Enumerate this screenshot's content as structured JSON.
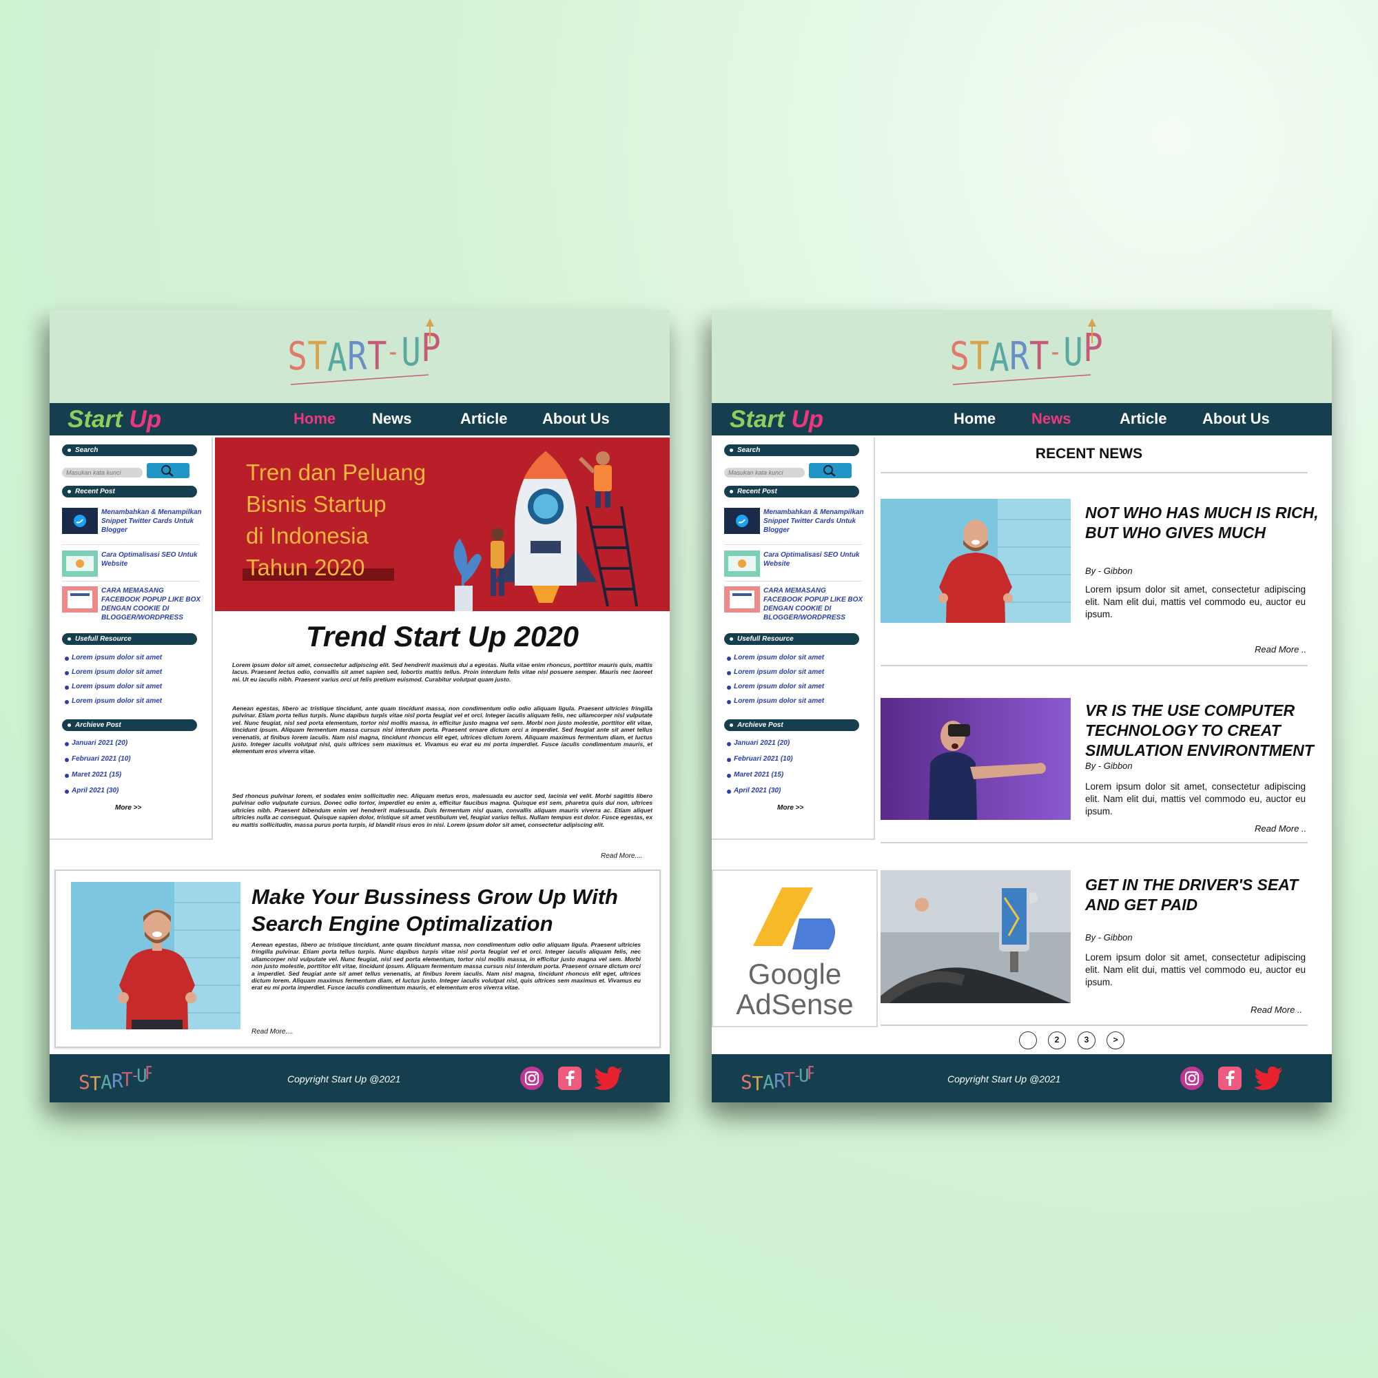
{
  "brand": {
    "part1": "Start",
    "part2": " Up"
  },
  "nav": [
    "Home",
    "News",
    "Article",
    "About Us"
  ],
  "sidebar": {
    "search_label": "Search",
    "search_placeholder": "Masukan kata kunci",
    "recent_label": "Recent Post",
    "recent_posts": [
      "Menambahkan & Menampilkan Snippet Twitter Cards Untuk Blogger",
      "Cara Optimalisasi SEO Untuk Website",
      "CARA MEMASANG FACEBOOK POPUP LIKE BOX DENGAN COOKIE DI BLOGGER/WORDPRESS"
    ],
    "resource_label": "Usefull Resource",
    "resources": [
      "Lorem ipsum dolor sit amet",
      "Lorem ipsum dolor sit amet",
      "Lorem ipsum dolor sit amet",
      "Lorem ipsum dolor sit amet"
    ],
    "archive_label": "Archieve Post",
    "archives": [
      "Januari 2021 (20)",
      "Februari 2021 (10)",
      "Maret 2021 (15)",
      "April 2021 (30)"
    ],
    "more": "More >>"
  },
  "home": {
    "hero_lines": [
      "Tren dan Peluang",
      "Bisnis Startup",
      "di Indonesia",
      "Tahun 2020"
    ],
    "article_title": "Trend Start Up 2020",
    "paragraphs": [
      "Lorem ipsum dolor sit amet, consectetur adipiscing elit. Sed hendrerit maximus dui a egestas. Nulla vitae enim rhoncus, porttitor mauris quis, mattis lacus. Praesent lectus odio, convallis sit amet sapien sed, lobortis mattis tellus. Proin interdum felis vitae nisl posuere semper. Mauris nec laoreet mi. Ut eu iaculis nibh. Praesent varius orci ut felis pretium euismod. Curabitur volutpat quam justo.",
      "Aenean egestas, libero ac tristique tincidunt, ante quam tincidunt massa, non condimentum odio odio aliquam ligula. Praesent ultricies fringilla pulvinar. Etiam porta tellus turpis. Nunc dapibus turpis vitae nisl porta feugiat vel et orci. Integer iaculis aliquam felis, nec ullamcorper nisl vulputate vel. Nunc feugiat, nisl sed porta elementum, tortor nisl mollis massa, in efficitur justo magna vel sem. Morbi non justo molestie, porttitor elit vitae, tincidunt ipsum. Aliquam fermentum massa cursus nisl interdum porta. Praesent ornare dictum orci a imperdiet. Sed feugiat ante sit amet tellus venenatis, at finibus lorem iaculis. Nam nisl magna, tincidunt rhoncus elit eget, ultrices dictum lorem. Aliquam maximus fermentum diam, et luctus justo. Integer iaculis volutpat nisl, quis ultrices sem maximus et. Vivamus eu erat eu mi porta imperdiet. Fusce iaculis condimentum mauris, et elementum eros viverra vitae.",
      "Sed rhoncus pulvinar lorem, et sodales enim sollicitudin nec. Aliquam metus eros, malesuada eu auctor sed, lacinia vel velit. Morbi sagittis libero pulvinar odio vulputate cursus. Donec odio tortor, imperdiet eu enim a, efficitur faucibus magna. Quisque est sem, pharetra quis dui non, ultrices ultricies nibh. Praesent bibendum enim vel hendrerit malesuada. Duis fermentum nisl quam, convallis aliquam mauris viverra ac. Etiam aliquet ultricies nulla ac consequat. Quisque sapien dolor, tristique sit amet vestibulum vel, feugiat varius tellus. Nullam tempus est dolor. Fusce egestas, ex eu mattis sollicitudin, massa purus porta turpis, id blandit risus eros in nisi. Lorem ipsum dolor sit amet, consectetur adipiscing elit."
    ],
    "read_more": "Read More....",
    "promo_title": "Make Your Bussiness Grow Up With Search Engine Optimalization",
    "promo_body": "Aenean egestas, libero ac tristique tincidunt, ante quam tincidunt massa, non condimentum odio odio aliquam ligula. Praesent ultricies fringilla pulvinar. Etiam porta tellus turpis. Nunc dapibus turpis vitae nisl porta feugiat vel et orci. Integer iaculis aliquam felis, nec ullamcorper nisl vulputate vel. Nunc feugiat, nisl sed porta elementum, tortor nisl mollis massa, in efficitur justo magna vel sem. Morbi non justo molestie, porttitor elit vitae, tincidunt ipsum. Aliquam fermentum massa cursus nisl interdum porta. Praesent ornare dictum orci a imperdiet. Sed feugiat ante sit amet tellus venenatis, at finibus lorem iaculis. Nam nisl magna, tincidunt rhoncus elit eget, ultrices dictum lorem. Aliquam maximus fermentum diam, et luctus justo. Integer iaculis volutpat nisl, quis ultrices sem maximus et. Vivamus eu erat eu mi porta imperdiet. Fusce iaculis condimentum mauris, et elementum eros viverra vitae.",
    "promo_read_more": "Read More...."
  },
  "news": {
    "section_title": "RECENT NEWS",
    "items": [
      {
        "title": "NOT WHO HAS MUCH IS RICH, BUT WHO GIVES MUCH",
        "by": "By - Gibbon",
        "body": "Lorem ipsum dolor sit amet, consectetur adipiscing elit. Nam elit dui, mattis vel commodo eu, auctor eu ipsum.",
        "read_more": "Read More .."
      },
      {
        "title": "VR IS THE USE COMPUTER TECHNOLOGY TO CREAT SIMULATION ENVIRONTMENT",
        "by": "By - Gibbon",
        "body": "Lorem ipsum dolor sit amet, consectetur adipiscing elit. Nam elit dui, mattis vel commodo eu, auctor eu ipsum.",
        "read_more": "Read More .."
      },
      {
        "title": "GET IN THE DRIVER'S SEAT AND GET PAID",
        "by": "By - Gibbon",
        "body": "Lorem ipsum dolor sit amet, consectetur adipiscing elit. Nam elit dui, mattis vel commodo eu, auctor eu ipsum.",
        "read_more": "Read More .."
      }
    ],
    "adsense": {
      "line1": "Google",
      "line2": "AdSense"
    },
    "pagination": [
      "",
      "2",
      "3",
      ">"
    ]
  },
  "footer": {
    "copyright": "Copyright Start Up @2021"
  },
  "colors": {
    "nav": "#153f4e",
    "accent": "#f0377d",
    "brand_green": "#8ccf5e",
    "header": "#cfe8d1",
    "hero": "#b81f28"
  }
}
